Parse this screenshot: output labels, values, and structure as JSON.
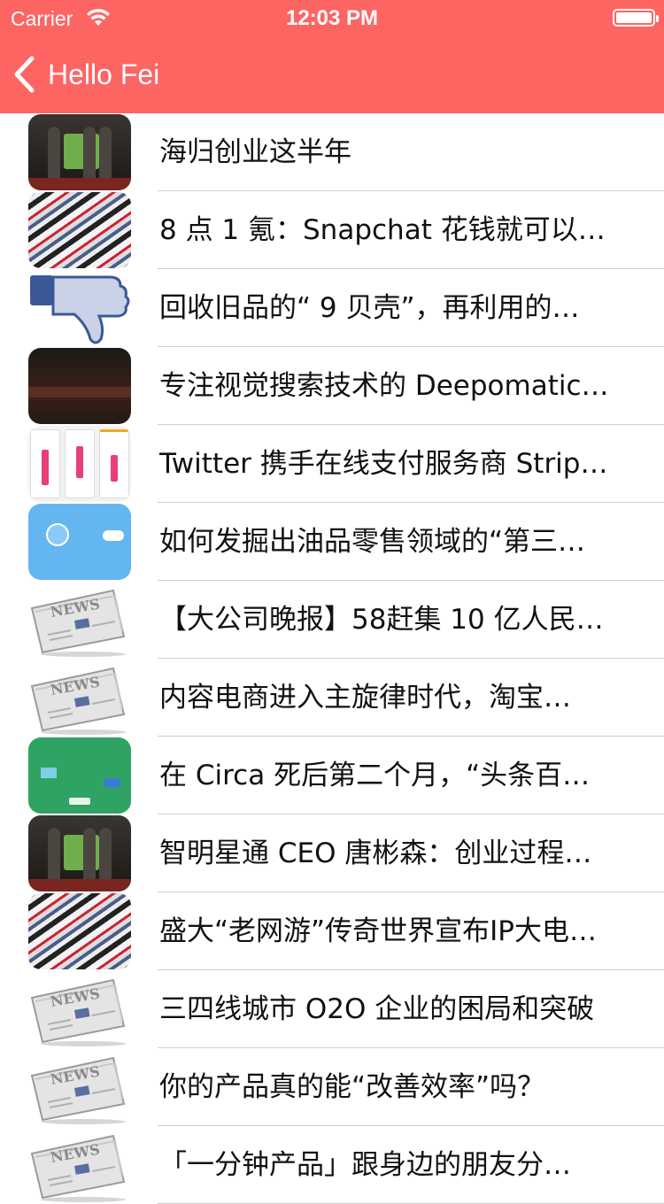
{
  "status_bar": {
    "carrier": "Carrier",
    "time": "12:03 PM"
  },
  "nav": {
    "back_label": "Hello Fei"
  },
  "colors": {
    "header": "#fd6563",
    "separator": "#cfcfd3"
  },
  "articles": [
    {
      "title": "海归创业这半年",
      "thumbnail": "stage-photo"
    },
    {
      "title": "8 点 1 氪：Snapchat 花钱就可以…",
      "thumbnail": "newspapers-photo"
    },
    {
      "title": "回收旧品的“ 9 贝壳”，再利用的…",
      "thumbnail": "thumbs-down-icon"
    },
    {
      "title": "专注视觉搜索技术的 Deepomatic…",
      "thumbnail": "dark-web-screenshot"
    },
    {
      "title": "Twitter 携手在线支付服务商 Strip…",
      "thumbnail": "app-screens"
    },
    {
      "title": "如何发掘出油品零售领域的“第三…",
      "thumbnail": "blue-app-screen"
    },
    {
      "title": "【大公司晚报】58赶集 10 亿人民…",
      "thumbnail": "news-icon"
    },
    {
      "title": "内容电商进入主旋律时代，淘宝…",
      "thumbnail": "news-icon"
    },
    {
      "title": "在 Circa 死后第二个月，“头条百…",
      "thumbnail": "green-app-screen"
    },
    {
      "title": "智明星通 CEO 唐彬森：创业过程…",
      "thumbnail": "stage-photo"
    },
    {
      "title": "盛大“老网游”传奇世界宣布IP大电…",
      "thumbnail": "newspapers-photo"
    },
    {
      "title": "三四线城市 O2O 企业的困局和突破",
      "thumbnail": "news-icon"
    },
    {
      "title": "你的产品真的能“改善效率”吗？",
      "thumbnail": "news-icon"
    },
    {
      "title": "「一分钟产品」跟身边的朋友分…",
      "thumbnail": "news-icon"
    }
  ]
}
